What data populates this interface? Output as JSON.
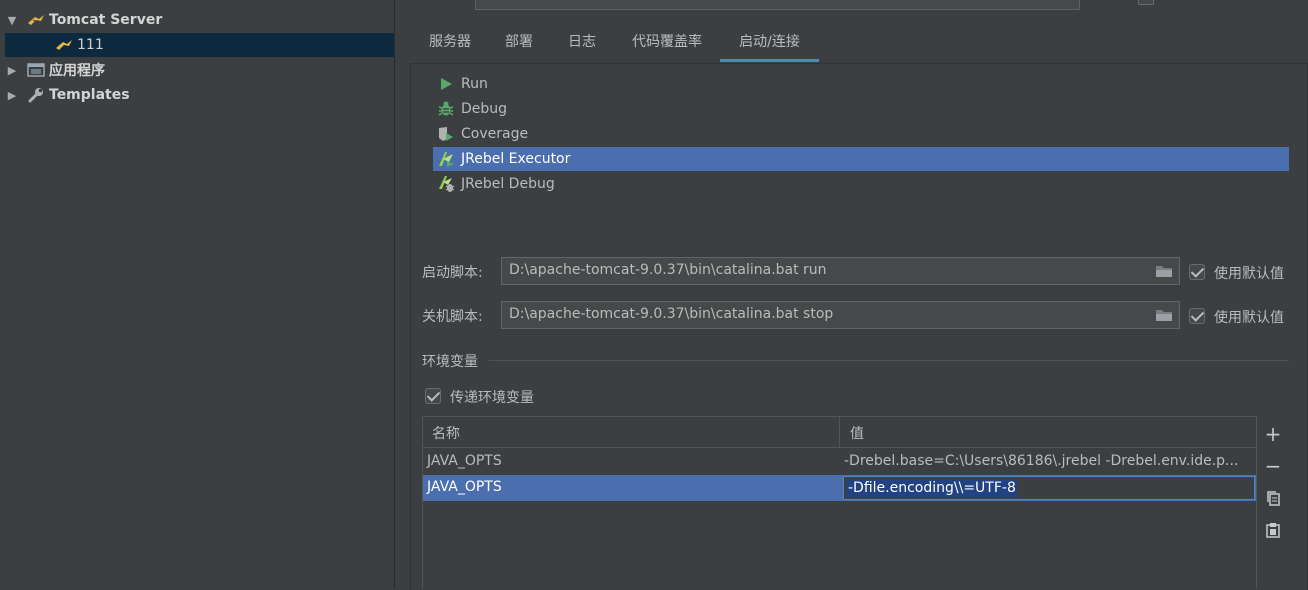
{
  "tree": {
    "items": [
      {
        "label": "Tomcat Server",
        "expanded": true
      },
      {
        "label": "111",
        "selected": true
      },
      {
        "label": "应用程序",
        "expanded": false
      },
      {
        "label": "Templates",
        "expanded": false
      }
    ]
  },
  "tabs": [
    {
      "label": "服务器"
    },
    {
      "label": "部署"
    },
    {
      "label": "日志"
    },
    {
      "label": "代码覆盖率"
    },
    {
      "label": "启动/连接",
      "active": true
    }
  ],
  "executors": [
    {
      "label": "Run",
      "icon": "run-icon"
    },
    {
      "label": "Debug",
      "icon": "debug-icon"
    },
    {
      "label": "Coverage",
      "icon": "coverage-icon"
    },
    {
      "label": "JRebel Executor",
      "icon": "jrebel-icon",
      "selected": true
    },
    {
      "label": "JRebel Debug",
      "icon": "jrebel-debug-icon"
    }
  ],
  "startup": {
    "label": "启动脚本:",
    "value": "D:\\apache-tomcat-9.0.37\\bin\\catalina.bat run",
    "use_default_label": "使用默认值",
    "use_default": true
  },
  "shutdown": {
    "label": "关机脚本:",
    "value": "D:\\apache-tomcat-9.0.37\\bin\\catalina.bat stop",
    "use_default_label": "使用默认值",
    "use_default": true
  },
  "env": {
    "section_title": "环境变量",
    "pass_env_label": "传递环境变量",
    "pass_env": true,
    "columns": [
      "名称",
      "值"
    ],
    "rows": [
      {
        "name": "JAVA_OPTS",
        "value": "-Drebel.base=C:\\Users\\86186\\.jrebel -Drebel.env.ide.p..."
      },
      {
        "name": "JAVA_OPTS",
        "value": "-Dfile.encoding\\\\=UTF-8",
        "selected": true
      }
    ]
  },
  "table_buttons": {
    "add": "+",
    "remove": "−"
  },
  "colors": {
    "accent": "#4a88c7",
    "selection": "#4b6eaf",
    "tree_selection": "#0d293e",
    "background": "#3c3f41"
  }
}
